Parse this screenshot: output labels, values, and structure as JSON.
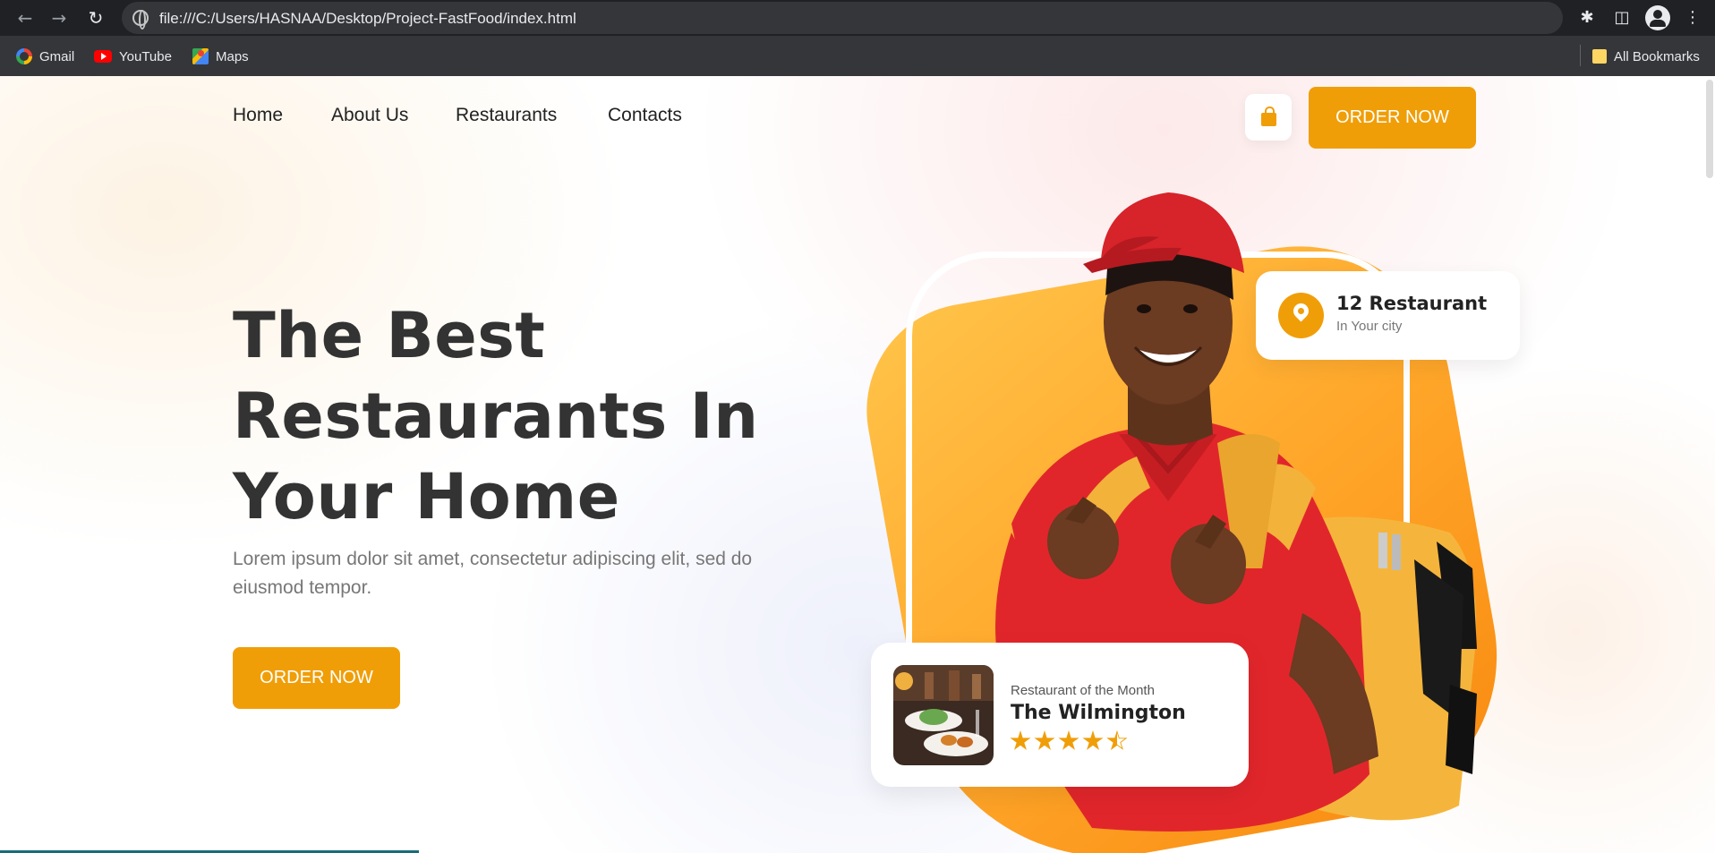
{
  "browser": {
    "url": "file:///C:/Users/HASNAA/Desktop/Project-FastFood/index.html",
    "bookmarks": [
      {
        "label": "Gmail",
        "icon": "gmail-icon"
      },
      {
        "label": "YouTube",
        "icon": "youtube-icon"
      },
      {
        "label": "Maps",
        "icon": "maps-icon"
      }
    ],
    "all_bookmarks": "All Bookmarks"
  },
  "nav": {
    "links": [
      "Home",
      "About Us",
      "Restaurants",
      "Contacts"
    ],
    "order_button": "ORDER NOW"
  },
  "hero": {
    "title_lines": [
      "The Best",
      "Restaurants In",
      "Your Home"
    ],
    "description": "Lorem ipsum dolor sit amet, consectetur adipiscing elit, sed do eiusmod tempor.",
    "order_button": "ORDER NOW"
  },
  "badge": {
    "title": "12 Restaurant",
    "subtitle": "In Your city"
  },
  "month_card": {
    "label": "Restaurant of the Month",
    "name": "The Wilmington",
    "rating": 4.5,
    "max_rating": 5
  },
  "colors": {
    "accent": "#f09e08",
    "heading": "#333333",
    "body_text": "#777777",
    "browser_dark": "#202124"
  }
}
